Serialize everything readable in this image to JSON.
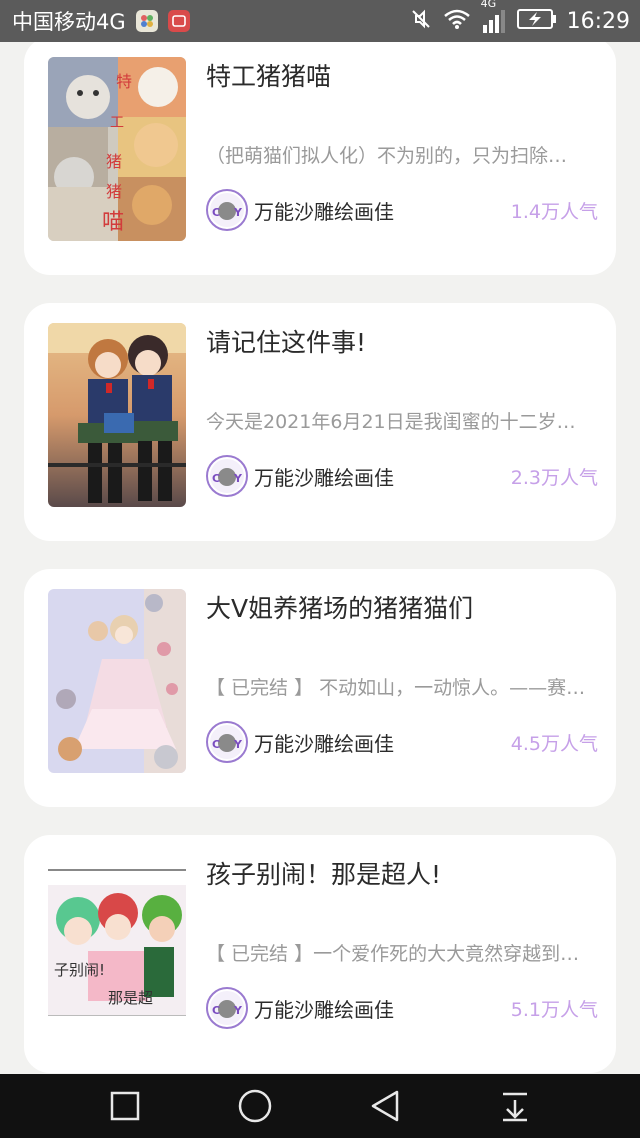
{
  "status_bar": {
    "carrier": "中国移动4G",
    "network": "4G",
    "time": "16:29"
  },
  "colors": {
    "accent_popularity": "#c6a0e8",
    "card_bg": "#ffffff",
    "page_bg": "#f2f2f0"
  },
  "cards": [
    {
      "title": "特工猪猪喵",
      "description": "（把萌猫们拟人化）不为别的，只为扫除…",
      "author": "万能沙雕绘画佳",
      "popularity": "1.4万人气",
      "cover_text": "特工猪猪喵"
    },
    {
      "title": "请记住这件事!",
      "description": "今天是2021年6月21日是我闺蜜的十二岁…",
      "author": "万能沙雕绘画佳",
      "popularity": "2.3万人气"
    },
    {
      "title": "大V姐养猪场的猪猪猫们",
      "description": "【 已完结 】 不动如山，一动惊人。——赛…",
      "author": "万能沙雕绘画佳",
      "popularity": "4.5万人气"
    },
    {
      "title": "孩子别闹！那是超人!",
      "description": "【 已完结 】一个爱作死的大大竟然穿越到…",
      "author": "万能沙雕绘画佳",
      "popularity": "5.1万人气",
      "cover_text": "孩子别闹！那是超人"
    }
  ],
  "nav_icons": [
    "square-recent-icon",
    "circle-home-icon",
    "triangle-back-icon",
    "pull-down-icon"
  ]
}
